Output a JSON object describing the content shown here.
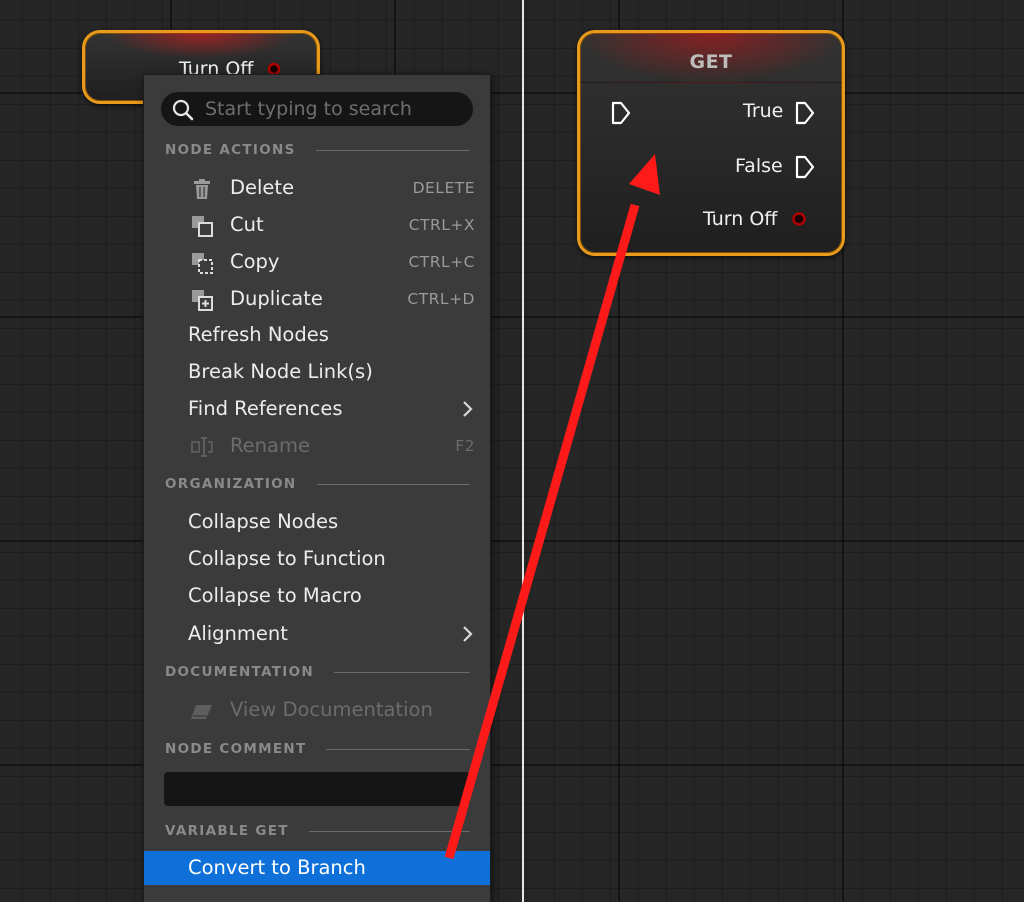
{
  "colors": {
    "node_border": "#e89a1c",
    "menu_background": "#3b3b3b",
    "selection": "#0e70d8",
    "annotation_arrow": "#ff1a1a",
    "exec_pin": "#ffffff",
    "bool_pin": "#b00000"
  },
  "left_node": {
    "label": "Turn Off",
    "pin_icon": "bool-pin-icon"
  },
  "get_node": {
    "title": "GET",
    "pins": {
      "exec_in": "exec-pin-icon",
      "true": "True",
      "false": "False",
      "turn_off": "Turn Off"
    }
  },
  "context_menu": {
    "search": {
      "placeholder": "Start typing to search",
      "value": "",
      "icon": "search-icon"
    },
    "sections": {
      "node_actions": "NODE ACTIONS",
      "organization": "ORGANIZATION",
      "documentation": "DOCUMENTATION",
      "node_comment": "NODE COMMENT",
      "variable_get": "VARIABLE GET"
    },
    "node_actions": [
      {
        "label": "Delete",
        "shortcut": "DELETE",
        "icon": "trash-icon"
      },
      {
        "label": "Cut",
        "shortcut": "CTRL+X",
        "icon": "cut-icon"
      },
      {
        "label": "Copy",
        "shortcut": "CTRL+C",
        "icon": "copy-icon"
      },
      {
        "label": "Duplicate",
        "shortcut": "CTRL+D",
        "icon": "duplicate-icon"
      },
      {
        "label": "Refresh Nodes"
      },
      {
        "label": "Break Node Link(s)"
      },
      {
        "label": "Find References",
        "submenu_icon": "chevron-right-icon"
      },
      {
        "label": "Rename",
        "shortcut": "F2",
        "icon": "rename-icon",
        "disabled": true
      }
    ],
    "organization": [
      {
        "label": "Collapse Nodes"
      },
      {
        "label": "Collapse to Function"
      },
      {
        "label": "Collapse to Macro"
      },
      {
        "label": "Alignment",
        "submenu_icon": "chevron-right-icon"
      }
    ],
    "documentation": [
      {
        "label": "View Documentation",
        "icon": "eraser-icon",
        "disabled": true
      }
    ],
    "node_comment": {
      "value": ""
    },
    "variable_get": [
      {
        "label": "Convert to Branch",
        "selected": true
      }
    ]
  }
}
